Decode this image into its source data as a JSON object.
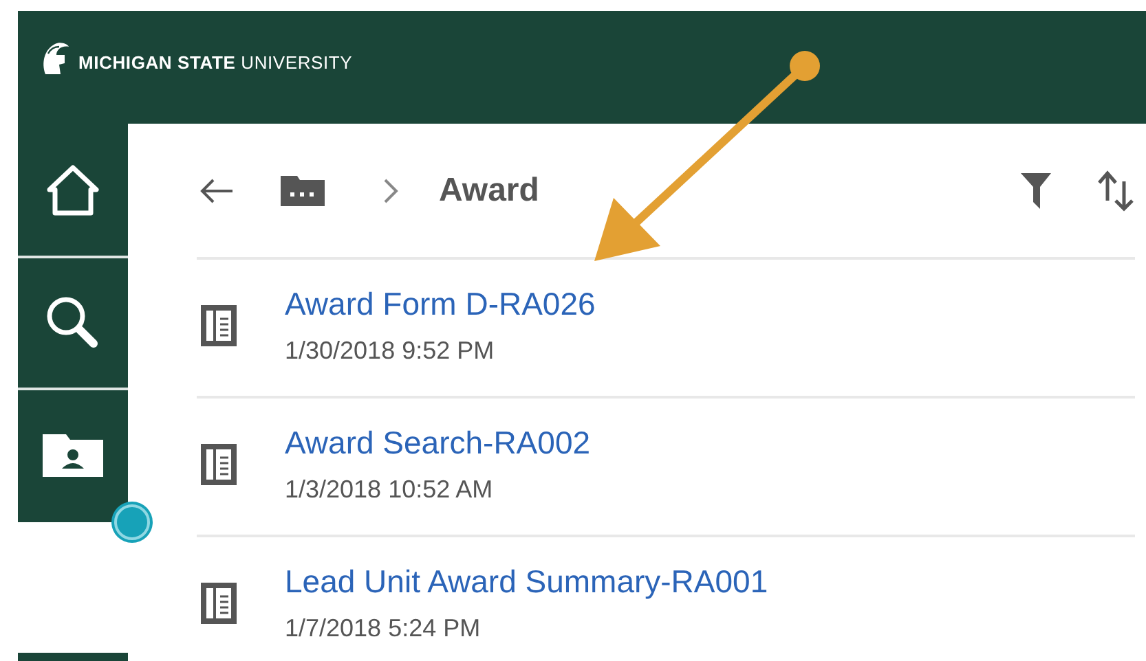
{
  "header": {
    "brand": "**MICHIGAN STATE** UNIVERSITY"
  },
  "sidebar": {
    "items": [
      {
        "kind": "home",
        "selected": false
      },
      {
        "kind": "search",
        "selected": false
      },
      {
        "kind": "folder",
        "selected": false
      }
    ]
  },
  "breadcrumb": {
    "current": "Award"
  },
  "items": [
    {
      "title": "Award Form D-RA026",
      "date": "1/30/2018 9:52 PM"
    },
    {
      "title": "Award Search-RA002",
      "date": "1/3/2018 10:52 AM"
    },
    {
      "title": "Lead Unit Award Summary-RA001",
      "date": "1/7/2018 5:24 PM"
    }
  ]
}
